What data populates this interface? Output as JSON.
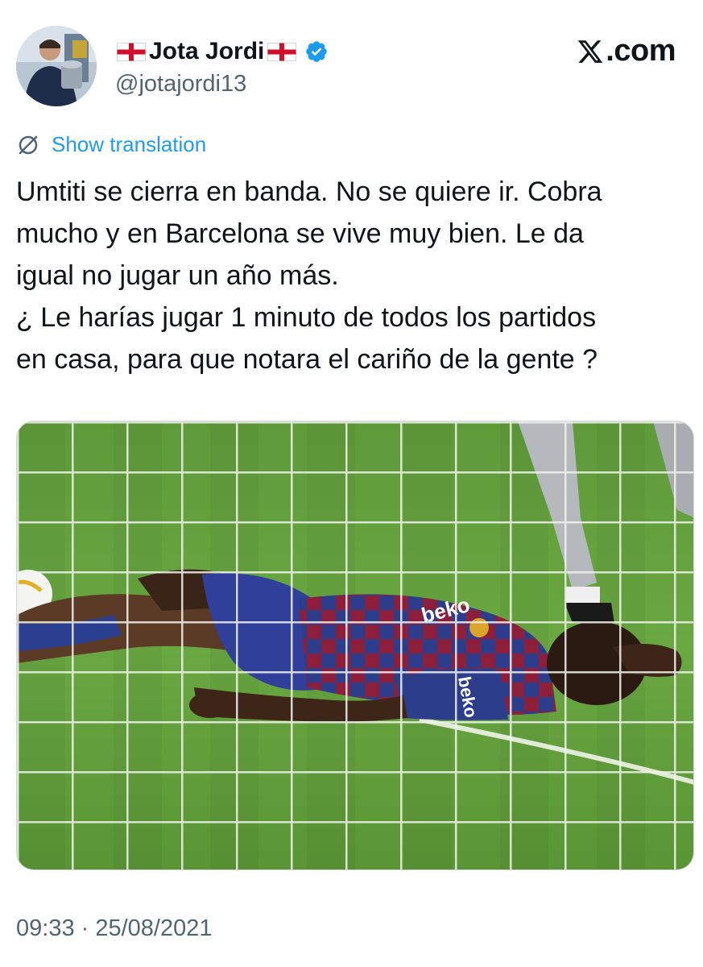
{
  "author": {
    "display_name": "Jota Jordi",
    "handle": "@jotajordi13",
    "flag_icon": "england-flag-icon",
    "verified_icon": "verified-badge-icon",
    "verified_color": "#1d9bf0"
  },
  "brand": {
    "label": ".com",
    "icon": "x-logo-icon"
  },
  "translation": {
    "label": "Show translation",
    "icon": "globe-slash-icon",
    "color": "#1d9bf0"
  },
  "tweet": {
    "lines": [
      "Umtiti se cierra en banda. No se quiere ir. Cobra",
      "mucho y en Barcelona se vive muy bien. Le da",
      "igual no jugar un año más.",
      "¿ Le harías jugar 1 minuto de todos los partidos",
      "en casa, para que notara el cariño de la gente ?"
    ]
  },
  "media": {
    "shirt_sponsor": "beko",
    "sleeve_sponsor": "beko"
  },
  "timestamp": "09:33 · 25/08/2021"
}
